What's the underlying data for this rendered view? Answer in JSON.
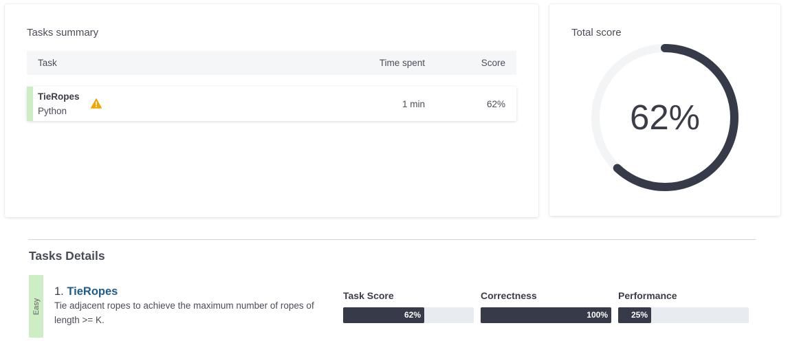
{
  "summary": {
    "title": "Tasks summary",
    "columns": {
      "task": "Task",
      "time": "Time spent",
      "score": "Score"
    },
    "rows": [
      {
        "name": "TieRopes",
        "language": "Python",
        "time": "1 min",
        "score": "62%",
        "warning_icon": "warning-triangle-icon"
      }
    ]
  },
  "total_score": {
    "title": "Total score",
    "value": "62%",
    "fraction": 0.62
  },
  "details": {
    "title": "Tasks Details",
    "tasks": [
      {
        "difficulty": "Easy",
        "number": "1.",
        "name": "TieRopes",
        "description": "Tie adjacent ropes to achieve the maximum number of ropes of length >= K.",
        "metrics": [
          {
            "label": "Task Score",
            "value": "62%",
            "fraction": 0.62
          },
          {
            "label": "Correctness",
            "value": "100%",
            "fraction": 1.0
          },
          {
            "label": "Performance",
            "value": "25%",
            "fraction": 0.25
          }
        ]
      }
    ]
  },
  "colors": {
    "accent_dark": "#373a48",
    "easy_green": "#cdeec5",
    "link_blue": "#1f5c8c",
    "warning": "#f5a300",
    "track": "#e8ebf0"
  }
}
